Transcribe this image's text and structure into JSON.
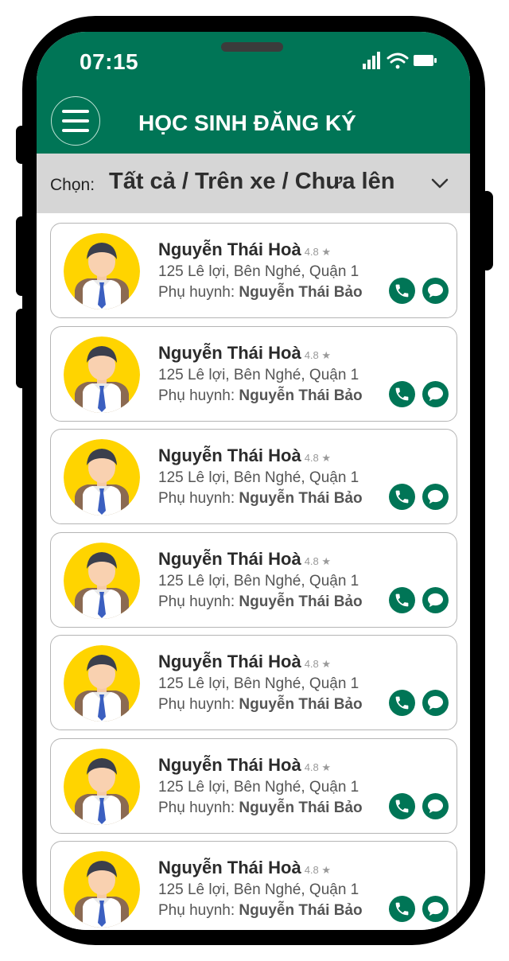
{
  "status_bar": {
    "time": "07:15"
  },
  "header": {
    "title": "HỌC SINH ĐĂNG KÝ",
    "menu_icon": "hamburger-menu-icon"
  },
  "filter": {
    "label": "Chọn:",
    "value": "Tất cả / Trên xe / Chưa lên"
  },
  "colors": {
    "primary": "#007556",
    "filter_bg": "#d6d6d6",
    "avatar_bg": "#ffd400"
  },
  "students": [
    {
      "name": "Nguyễn Thái Hoà",
      "rating": "4.8",
      "address": "125 Lê lợi, Bên Nghé, Quận 1",
      "parent_label": "Phụ huynh:",
      "parent_name": "Nguyễn Thái Bảo"
    },
    {
      "name": "Nguyễn Thái Hoà",
      "rating": "4.8",
      "address": "125 Lê lợi, Bên Nghé, Quận 1",
      "parent_label": "Phụ huynh:",
      "parent_name": "Nguyễn Thái Bảo"
    },
    {
      "name": "Nguyễn Thái Hoà",
      "rating": "4.8",
      "address": "125 Lê lợi, Bên Nghé, Quận 1",
      "parent_label": "Phụ huynh:",
      "parent_name": "Nguyễn Thái Bảo"
    },
    {
      "name": "Nguyễn Thái Hoà",
      "rating": "4.8",
      "address": "125 Lê lợi, Bên Nghé, Quận 1",
      "parent_label": "Phụ huynh:",
      "parent_name": "Nguyễn Thái Bảo"
    },
    {
      "name": "Nguyễn Thái Hoà",
      "rating": "4.8",
      "address": "125 Lê lợi, Bên Nghé, Quận 1",
      "parent_label": "Phụ huynh:",
      "parent_name": "Nguyễn Thái Bảo"
    },
    {
      "name": "Nguyễn Thái Hoà",
      "rating": "4.8",
      "address": "125 Lê lợi, Bên Nghé, Quận 1",
      "parent_label": "Phụ huynh:",
      "parent_name": "Nguyễn Thái Bảo"
    },
    {
      "name": "Nguyễn Thái Hoà",
      "rating": "4.8",
      "address": "125 Lê lợi, Bên Nghé, Quận 1",
      "parent_label": "Phụ huynh:",
      "parent_name": "Nguyễn Thái Bảo"
    }
  ]
}
